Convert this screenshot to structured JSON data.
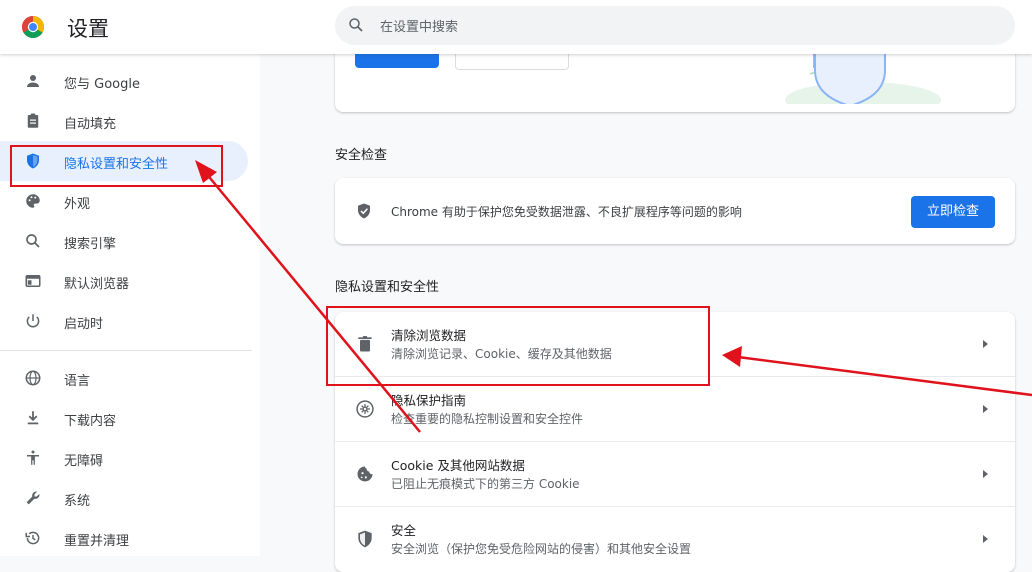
{
  "header": {
    "title": "设置",
    "search_placeholder": "在设置中搜索"
  },
  "sidebar": {
    "items": [
      {
        "label": "您与 Google",
        "icon": "person-icon"
      },
      {
        "label": "自动填充",
        "icon": "clipboard-icon"
      },
      {
        "label": "隐私设置和安全性",
        "icon": "shield-icon",
        "active": true
      },
      {
        "label": "外观",
        "icon": "palette-icon"
      },
      {
        "label": "搜索引擎",
        "icon": "search-icon"
      },
      {
        "label": "默认浏览器",
        "icon": "browser-window-icon"
      },
      {
        "label": "启动时",
        "icon": "power-icon"
      },
      {
        "label": "语言",
        "icon": "globe-icon"
      },
      {
        "label": "下载内容",
        "icon": "download-icon"
      },
      {
        "label": "无障碍",
        "icon": "accessibility-icon"
      },
      {
        "label": "系统",
        "icon": "wrench-icon"
      },
      {
        "label": "重置并清理",
        "icon": "history-icon"
      }
    ]
  },
  "safety_check": {
    "section_title": "安全检查",
    "description": "Chrome 有助于保护您免受数据泄露、不良扩展程序等问题的影响",
    "button_label": "立即检查"
  },
  "privacy": {
    "section_title": "隐私设置和安全性",
    "rows": [
      {
        "title": "清除浏览数据",
        "subtitle": "清除浏览记录、Cookie、缓存及其他数据",
        "icon": "trash-icon"
      },
      {
        "title": "隐私保护指南",
        "subtitle": "检查重要的隐私控制设置和安全控件",
        "icon": "privacy-guide-icon"
      },
      {
        "title": "Cookie 及其他网站数据",
        "subtitle": "已阻止无痕模式下的第三方 Cookie",
        "icon": "cookie-icon"
      },
      {
        "title": "安全",
        "subtitle": "安全浏览（保护您免受危险网站的侵害）和其他安全设置",
        "icon": "security-shield-icon"
      }
    ]
  },
  "colors": {
    "accent": "#1a73e8",
    "annotation": "#e0121b",
    "active_nav_bg": "#e8f0fe"
  }
}
